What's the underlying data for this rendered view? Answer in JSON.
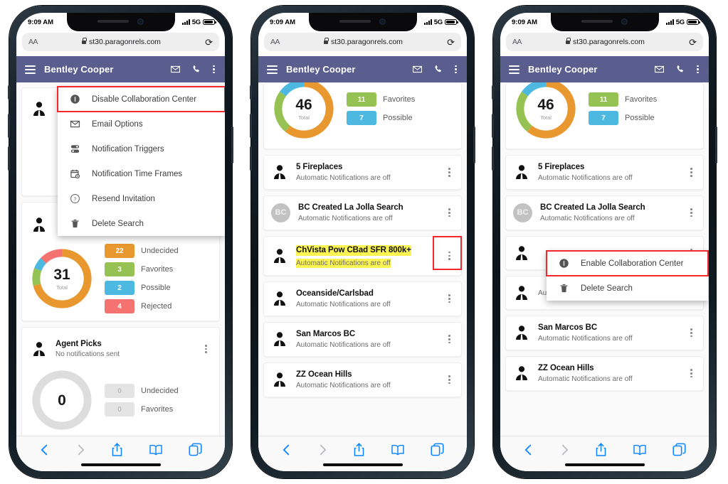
{
  "status_bar": {
    "time": "9:09 AM",
    "network": "5G"
  },
  "browser": {
    "aa_label": "AA",
    "url": "st30.paragonrels.com",
    "reload_icon": "reload-icon",
    "nav": {
      "back": "back-icon",
      "forward": "forward-icon",
      "share": "share-icon",
      "bookmarks": "bookmarks-icon",
      "tabs": "tabs-icon"
    }
  },
  "app_header": {
    "menu_icon": "hamburger-icon",
    "title": "Bentley Cooper",
    "mail_icon": "mail-icon",
    "phone_icon": "phone-icon",
    "overflow_icon": "kebab-menu-icon"
  },
  "phone1": {
    "menu": {
      "items": [
        {
          "label": "Disable Collaboration Center",
          "icon": "info-icon",
          "highlighted": true
        },
        {
          "label": "Email Options",
          "icon": "mail-icon",
          "highlighted": false
        },
        {
          "label": "Notification Triggers",
          "icon": "triggers-icon",
          "highlighted": false
        },
        {
          "label": "Notification Time Frames",
          "icon": "calendar-clock-icon",
          "highlighted": false
        },
        {
          "label": "Resend Invitation",
          "icon": "question-circle-icon",
          "highlighted": false
        },
        {
          "label": "Delete Search",
          "icon": "trash-icon",
          "highlighted": false
        }
      ]
    },
    "card_partial": {
      "avatar_icon": "agent-avatar-icon"
    },
    "card_31": {
      "avatar_icon": "agent-avatar-icon",
      "total": "31",
      "total_label": "Total",
      "legend": [
        {
          "count": "22",
          "label": "Undecided",
          "color": "#e8982f"
        },
        {
          "count": "3",
          "label": "Favorites",
          "color": "#96c153"
        },
        {
          "count": "2",
          "label": "Possible",
          "color": "#4db8e0"
        },
        {
          "count": "4",
          "label": "Rejected",
          "color": "#f4726f"
        }
      ]
    },
    "card_agent_picks": {
      "avatar_icon": "agent-avatar-icon",
      "title": "Agent Picks",
      "subtitle": "No notifications sent",
      "total": "0",
      "legend": [
        {
          "count": "0",
          "label": "Undecided",
          "color": "#e0e0e0"
        },
        {
          "count": "0",
          "label": "Favorites",
          "color": "#e0e0e0"
        }
      ]
    }
  },
  "phone2": {
    "summary_card": {
      "total": "46",
      "total_label": "Total",
      "legend": [
        {
          "count": "11",
          "label": "Favorites",
          "color": "#96c153"
        },
        {
          "count": "7",
          "label": "Possible",
          "color": "#4db8e0"
        }
      ]
    },
    "rows": [
      {
        "title": "5 Fireplaces",
        "subtitle": "Automatic Notifications are off",
        "avatar": "agent-avatar-icon",
        "initials": "",
        "highlight": false,
        "kebab_boxed": false
      },
      {
        "title": "BC Created La Jolla Search",
        "subtitle": "Automatic Notifications are off",
        "avatar": "initials-avatar",
        "initials": "BC",
        "highlight": false,
        "kebab_boxed": false
      },
      {
        "title": "ChVista Pow CBad SFR 800k+",
        "subtitle": "Automatic Notifications are off",
        "avatar": "agent-avatar-icon",
        "initials": "",
        "highlight": true,
        "kebab_boxed": true
      },
      {
        "title": "Oceanside/Carlsbad",
        "subtitle": "Automatic Notifications are off",
        "avatar": "agent-avatar-icon",
        "initials": "",
        "highlight": false,
        "kebab_boxed": false
      },
      {
        "title": "San Marcos BC",
        "subtitle": "Automatic Notifications are off",
        "avatar": "agent-avatar-icon",
        "initials": "",
        "highlight": false,
        "kebab_boxed": false
      },
      {
        "title": "ZZ Ocean Hills",
        "subtitle": "Automatic Notifications are off",
        "avatar": "agent-avatar-icon",
        "initials": "",
        "highlight": false,
        "kebab_boxed": false
      }
    ]
  },
  "phone3": {
    "summary_card": {
      "total": "46",
      "total_label": "Total",
      "legend": [
        {
          "count": "11",
          "label": "Favorites",
          "color": "#96c153"
        },
        {
          "count": "7",
          "label": "Possible",
          "color": "#4db8e0"
        }
      ]
    },
    "rows": [
      {
        "title": "5 Fireplaces",
        "subtitle": "Automatic Notifications are off",
        "avatar": "agent-avatar-icon",
        "initials": ""
      },
      {
        "title": "BC Created La Jolla Search",
        "subtitle": "Automatic Notifications are off",
        "avatar": "initials-avatar",
        "initials": "BC"
      },
      {
        "title": "",
        "subtitle": "",
        "avatar": "agent-avatar-icon",
        "initials": ""
      },
      {
        "title": "",
        "subtitle": "Automatic Notifications are off",
        "avatar": "agent-avatar-icon",
        "initials": ""
      },
      {
        "title": "San Marcos BC",
        "subtitle": "Automatic Notifications are off",
        "avatar": "agent-avatar-icon",
        "initials": ""
      },
      {
        "title": "ZZ Ocean Hills",
        "subtitle": "Automatic Notifications are off",
        "avatar": "agent-avatar-icon",
        "initials": ""
      }
    ],
    "menu": {
      "items": [
        {
          "label": "Enable Collaboration Center",
          "icon": "info-icon",
          "highlighted": true
        },
        {
          "label": "Delete Search",
          "icon": "trash-icon",
          "highlighted": false
        }
      ]
    }
  },
  "chart_data": [
    {
      "type": "pie",
      "title": "Collaboration summary (phone 1, partially hidden)",
      "labels": [
        "Undecided",
        "Favorites",
        "Possible",
        "Rejected"
      ],
      "values": [
        22,
        3,
        2,
        4
      ],
      "total": 31,
      "colors": [
        "#e8982f",
        "#96c153",
        "#4db8e0",
        "#f4726f"
      ],
      "legend": "right"
    },
    {
      "type": "pie",
      "title": "Collaboration summary (phone 2 & 3, top card)",
      "labels": [
        "Undecided",
        "Favorites",
        "Possible"
      ],
      "values": [
        28,
        11,
        7
      ],
      "total": 46,
      "colors": [
        "#e8982f",
        "#96c153",
        "#4db8e0"
      ],
      "legend": "right",
      "visible_legend_labels": [
        "Favorites",
        "Possible"
      ],
      "visible_legend_values": [
        11,
        7
      ]
    },
    {
      "type": "pie",
      "title": "Agent Picks (phone 1, bottom card)",
      "labels": [
        "Undecided",
        "Favorites"
      ],
      "values": [
        0,
        0
      ],
      "total": 0,
      "colors": [
        "#e0e0e0",
        "#e0e0e0"
      ],
      "legend": "right"
    }
  ],
  "colors": {
    "app_header": "#5a5e8e",
    "highlight_outline": "#f4272b",
    "row_highlight": "#fcf450",
    "safari_accent": "#0a84ff"
  }
}
